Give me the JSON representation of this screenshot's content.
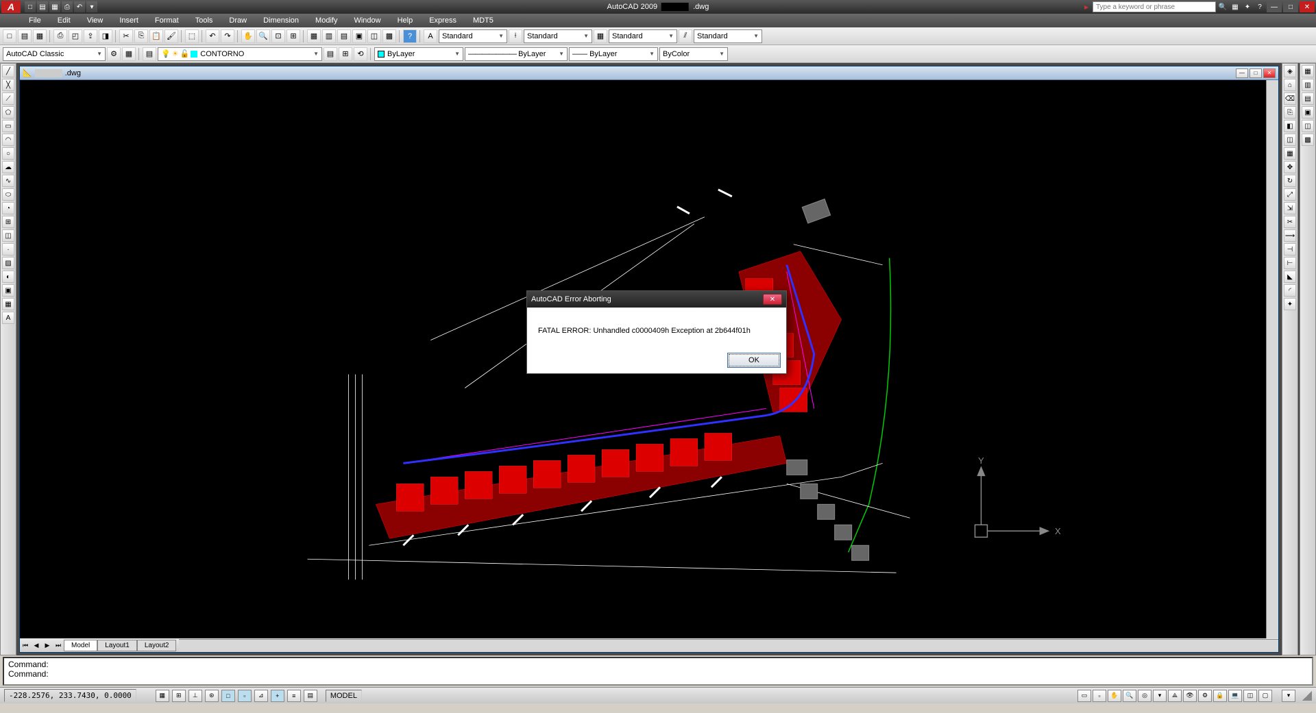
{
  "app": {
    "title_prefix": "AutoCAD 2009",
    "title_file": ".dwg",
    "search_placeholder": "Type a keyword or phrase"
  },
  "menu": [
    "File",
    "Edit",
    "View",
    "Insert",
    "Format",
    "Tools",
    "Draw",
    "Dimension",
    "Modify",
    "Window",
    "Help",
    "Express",
    "MDT5"
  ],
  "workspace": {
    "name": "AutoCAD Classic",
    "layer": "CONTORNO",
    "style1": "Standard",
    "style2": "Standard",
    "style3": "Standard",
    "style4": "Standard",
    "linetype": "ByLayer",
    "linetype2": "ByLayer",
    "plotstyle": "ByColor",
    "color": "ByLayer"
  },
  "doc": {
    "filename": ".dwg",
    "tabs": [
      "Model",
      "Layout1",
      "Layout2"
    ]
  },
  "command": {
    "line1": "Command:",
    "line2": "Command:"
  },
  "status": {
    "coords": "-228.2576, 233.7430, 0.0000",
    "model": "MODEL"
  },
  "error": {
    "title": "AutoCAD Error Aborting",
    "message": "FATAL ERROR:  Unhandled c0000409h Exception at 2b644f01h",
    "ok": "OK"
  },
  "ucs": {
    "x": "X",
    "y": "Y"
  },
  "toolbar_icons": {
    "new": "◫",
    "open": "📁",
    "save": "💾",
    "print": "🖶",
    "dropdown": "▾"
  }
}
